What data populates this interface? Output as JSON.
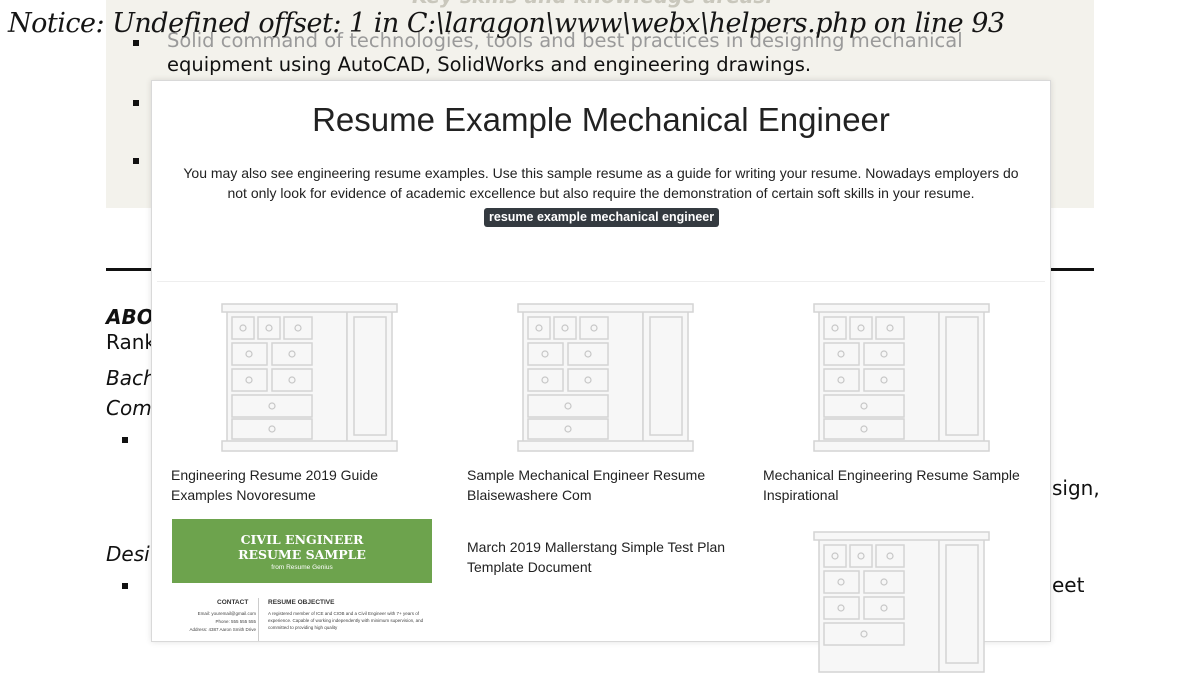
{
  "error_notice": "Notice: Undefined offset: 1 in C:\\laragon\\www\\webx\\helpers.php on line 93",
  "background": {
    "skills_heading": "Key skills and knowledge areas:",
    "bullet_line_1": "Solid command of technologies, tools and best practices in designing mechanical",
    "bullet_line_2": "equipment using AutoCAD, SolidWorks and engineering drawings.",
    "side_about": "ABO",
    "side_rank": "Rank",
    "side_bach": "Bach",
    "side_com": "Com",
    "side_desi": "Desi",
    "right_sign": "sign,",
    "right_eet": "eet"
  },
  "modal": {
    "title": "Resume Example Mechanical Engineer",
    "description": "You may also see engineering resume examples. Use this sample resume as a guide for writing your resume. Nowadays employers do not only look for evidence of academic excellence but also require the demonstration of certain soft skills in your resume.",
    "tag": "resume example mechanical engineer",
    "cards": [
      {
        "title": "Engineering Resume 2019 Guide Examples Novoresume",
        "image": "dresser-icon"
      },
      {
        "title": "Sample Mechanical Engineer Resume Blaisewashere Com",
        "image": "dresser-icon"
      },
      {
        "title": "Mechanical Engineering Resume Sample Inspirational",
        "image": "dresser-icon"
      },
      {
        "title": "",
        "image": "civil-engineer-resume-thumbnail"
      },
      {
        "title": "March 2019 Mallerstang Simple Test Plan Template Document",
        "image": ""
      },
      {
        "title": "",
        "image": "dresser-icon"
      }
    ],
    "civil_thumb": {
      "heading_line_1": "CIVIL ENGINEER",
      "heading_line_2": "RESUME SAMPLE",
      "subheading": "from Resume Genius",
      "contact_label": "CONTACT",
      "objective_label": "RESUME OBJECTIVE",
      "contact_email": "Email: youremail@gmail.com",
      "contact_phone": "Phone: 555 555 555",
      "contact_address": "Address: 4387 Aaron Smith Drive",
      "objective_text": "A registered member of ICE and CIOB and a Civil Engineer with 7+ years of experience. Capable of working independently with minimum supervision, and committed to providing high quality"
    }
  },
  "colors": {
    "accent_tag": "#343a40",
    "civil_green": "#6da34d",
    "band": "#f3f2ec"
  }
}
